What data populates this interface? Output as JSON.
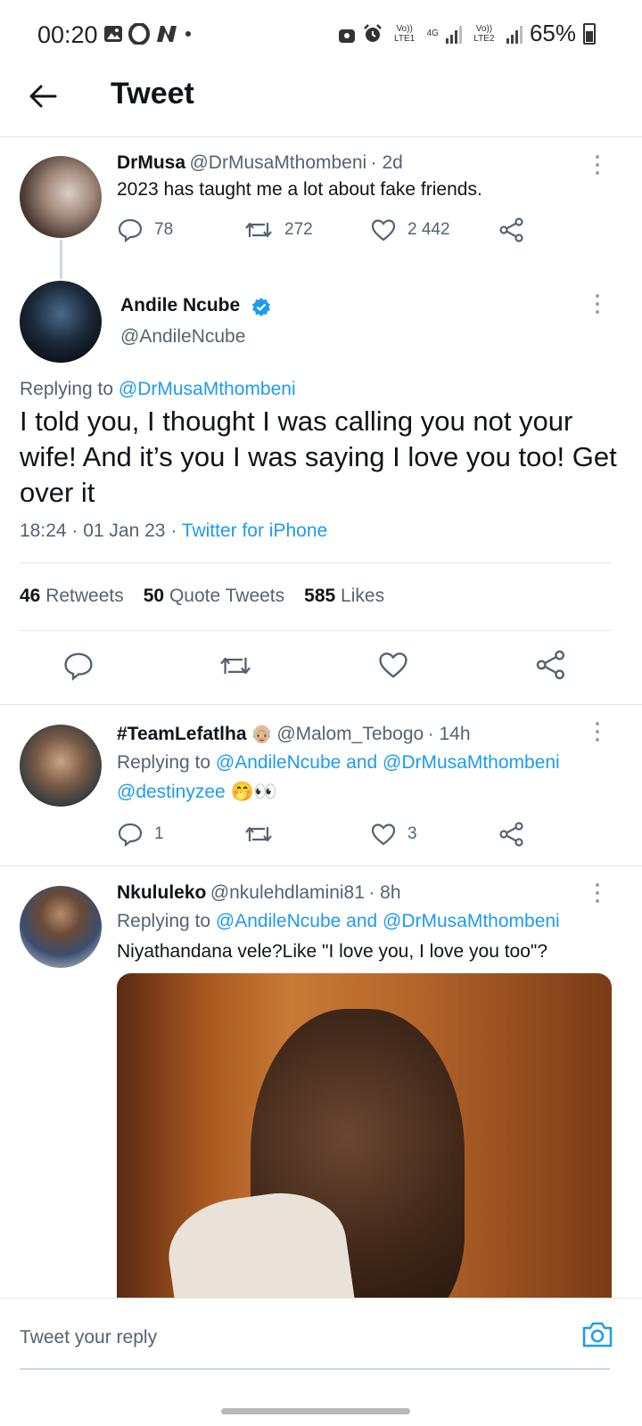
{
  "status_bar": {
    "time": "00:20",
    "network_1": "Vo)) LTE1",
    "network_type": "4G",
    "network_2": "Vo)) LTE2",
    "battery": "65%"
  },
  "header": {
    "title": "Tweet"
  },
  "parent_tweet": {
    "name": "DrMusa",
    "handle": "@DrMusaMthombeni",
    "time": "· 2d",
    "text": "2023 has taught me a lot about fake friends.",
    "replies": "78",
    "retweets": "272",
    "likes": "2 442"
  },
  "main_tweet": {
    "name": "Andile Ncube",
    "handle": "@AndileNcube",
    "replying_prefix": "Replying to",
    "replying_to": "@DrMusaMthombeni",
    "text": "I told you, I thought I was calling you not your wife! And it’s you I was saying I love you too! Get over it",
    "time": "18:24",
    "date": "01 Jan 23",
    "source": "Twitter for iPhone",
    "retweets_count": "46",
    "retweets_label": "Retweets",
    "quotes_count": "50",
    "quotes_label": "Quote Tweets",
    "likes_count": "585",
    "likes_label": "Likes"
  },
  "reply_1": {
    "name": "#TeamLefatlha",
    "emoji": "👴🏼",
    "handle": "@Malom_Tebogo",
    "time": "· 14h",
    "replying_prefix": "Replying to",
    "replying_to": "@AndileNcube and @DrMusaMthombeni",
    "mention": "@destinyzee",
    "text_emoji": "🤭👀",
    "replies": "1",
    "likes": "3"
  },
  "reply_2": {
    "name": "Nkululeko",
    "handle": "@nkulehdlamini81",
    "time": "· 8h",
    "replying_prefix": "Replying to",
    "replying_to": "@AndileNcube and @DrMusaMthombeni",
    "text": "Niyathandana vele?Like \"I love you, I love you too\"?"
  },
  "reply_box": {
    "placeholder": "Tweet your reply"
  },
  "colors": {
    "accent": "#1d9bf0",
    "text": "#0f1419",
    "muted": "#536471"
  }
}
